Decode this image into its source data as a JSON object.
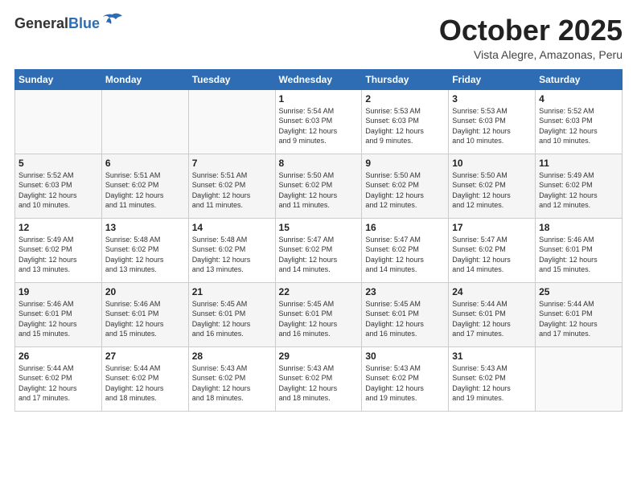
{
  "header": {
    "logo_general": "General",
    "logo_blue": "Blue",
    "month_title": "October 2025",
    "location": "Vista Alegre, Amazonas, Peru"
  },
  "weekdays": [
    "Sunday",
    "Monday",
    "Tuesday",
    "Wednesday",
    "Thursday",
    "Friday",
    "Saturday"
  ],
  "weeks": [
    [
      {
        "day": "",
        "info": ""
      },
      {
        "day": "",
        "info": ""
      },
      {
        "day": "",
        "info": ""
      },
      {
        "day": "1",
        "info": "Sunrise: 5:54 AM\nSunset: 6:03 PM\nDaylight: 12 hours\nand 9 minutes."
      },
      {
        "day": "2",
        "info": "Sunrise: 5:53 AM\nSunset: 6:03 PM\nDaylight: 12 hours\nand 9 minutes."
      },
      {
        "day": "3",
        "info": "Sunrise: 5:53 AM\nSunset: 6:03 PM\nDaylight: 12 hours\nand 10 minutes."
      },
      {
        "day": "4",
        "info": "Sunrise: 5:52 AM\nSunset: 6:03 PM\nDaylight: 12 hours\nand 10 minutes."
      }
    ],
    [
      {
        "day": "5",
        "info": "Sunrise: 5:52 AM\nSunset: 6:03 PM\nDaylight: 12 hours\nand 10 minutes."
      },
      {
        "day": "6",
        "info": "Sunrise: 5:51 AM\nSunset: 6:02 PM\nDaylight: 12 hours\nand 11 minutes."
      },
      {
        "day": "7",
        "info": "Sunrise: 5:51 AM\nSunset: 6:02 PM\nDaylight: 12 hours\nand 11 minutes."
      },
      {
        "day": "8",
        "info": "Sunrise: 5:50 AM\nSunset: 6:02 PM\nDaylight: 12 hours\nand 11 minutes."
      },
      {
        "day": "9",
        "info": "Sunrise: 5:50 AM\nSunset: 6:02 PM\nDaylight: 12 hours\nand 12 minutes."
      },
      {
        "day": "10",
        "info": "Sunrise: 5:50 AM\nSunset: 6:02 PM\nDaylight: 12 hours\nand 12 minutes."
      },
      {
        "day": "11",
        "info": "Sunrise: 5:49 AM\nSunset: 6:02 PM\nDaylight: 12 hours\nand 12 minutes."
      }
    ],
    [
      {
        "day": "12",
        "info": "Sunrise: 5:49 AM\nSunset: 6:02 PM\nDaylight: 12 hours\nand 13 minutes."
      },
      {
        "day": "13",
        "info": "Sunrise: 5:48 AM\nSunset: 6:02 PM\nDaylight: 12 hours\nand 13 minutes."
      },
      {
        "day": "14",
        "info": "Sunrise: 5:48 AM\nSunset: 6:02 PM\nDaylight: 12 hours\nand 13 minutes."
      },
      {
        "day": "15",
        "info": "Sunrise: 5:47 AM\nSunset: 6:02 PM\nDaylight: 12 hours\nand 14 minutes."
      },
      {
        "day": "16",
        "info": "Sunrise: 5:47 AM\nSunset: 6:02 PM\nDaylight: 12 hours\nand 14 minutes."
      },
      {
        "day": "17",
        "info": "Sunrise: 5:47 AM\nSunset: 6:02 PM\nDaylight: 12 hours\nand 14 minutes."
      },
      {
        "day": "18",
        "info": "Sunrise: 5:46 AM\nSunset: 6:01 PM\nDaylight: 12 hours\nand 15 minutes."
      }
    ],
    [
      {
        "day": "19",
        "info": "Sunrise: 5:46 AM\nSunset: 6:01 PM\nDaylight: 12 hours\nand 15 minutes."
      },
      {
        "day": "20",
        "info": "Sunrise: 5:46 AM\nSunset: 6:01 PM\nDaylight: 12 hours\nand 15 minutes."
      },
      {
        "day": "21",
        "info": "Sunrise: 5:45 AM\nSunset: 6:01 PM\nDaylight: 12 hours\nand 16 minutes."
      },
      {
        "day": "22",
        "info": "Sunrise: 5:45 AM\nSunset: 6:01 PM\nDaylight: 12 hours\nand 16 minutes."
      },
      {
        "day": "23",
        "info": "Sunrise: 5:45 AM\nSunset: 6:01 PM\nDaylight: 12 hours\nand 16 minutes."
      },
      {
        "day": "24",
        "info": "Sunrise: 5:44 AM\nSunset: 6:01 PM\nDaylight: 12 hours\nand 17 minutes."
      },
      {
        "day": "25",
        "info": "Sunrise: 5:44 AM\nSunset: 6:01 PM\nDaylight: 12 hours\nand 17 minutes."
      }
    ],
    [
      {
        "day": "26",
        "info": "Sunrise: 5:44 AM\nSunset: 6:02 PM\nDaylight: 12 hours\nand 17 minutes."
      },
      {
        "day": "27",
        "info": "Sunrise: 5:44 AM\nSunset: 6:02 PM\nDaylight: 12 hours\nand 18 minutes."
      },
      {
        "day": "28",
        "info": "Sunrise: 5:43 AM\nSunset: 6:02 PM\nDaylight: 12 hours\nand 18 minutes."
      },
      {
        "day": "29",
        "info": "Sunrise: 5:43 AM\nSunset: 6:02 PM\nDaylight: 12 hours\nand 18 minutes."
      },
      {
        "day": "30",
        "info": "Sunrise: 5:43 AM\nSunset: 6:02 PM\nDaylight: 12 hours\nand 19 minutes."
      },
      {
        "day": "31",
        "info": "Sunrise: 5:43 AM\nSunset: 6:02 PM\nDaylight: 12 hours\nand 19 minutes."
      },
      {
        "day": "",
        "info": ""
      }
    ]
  ]
}
